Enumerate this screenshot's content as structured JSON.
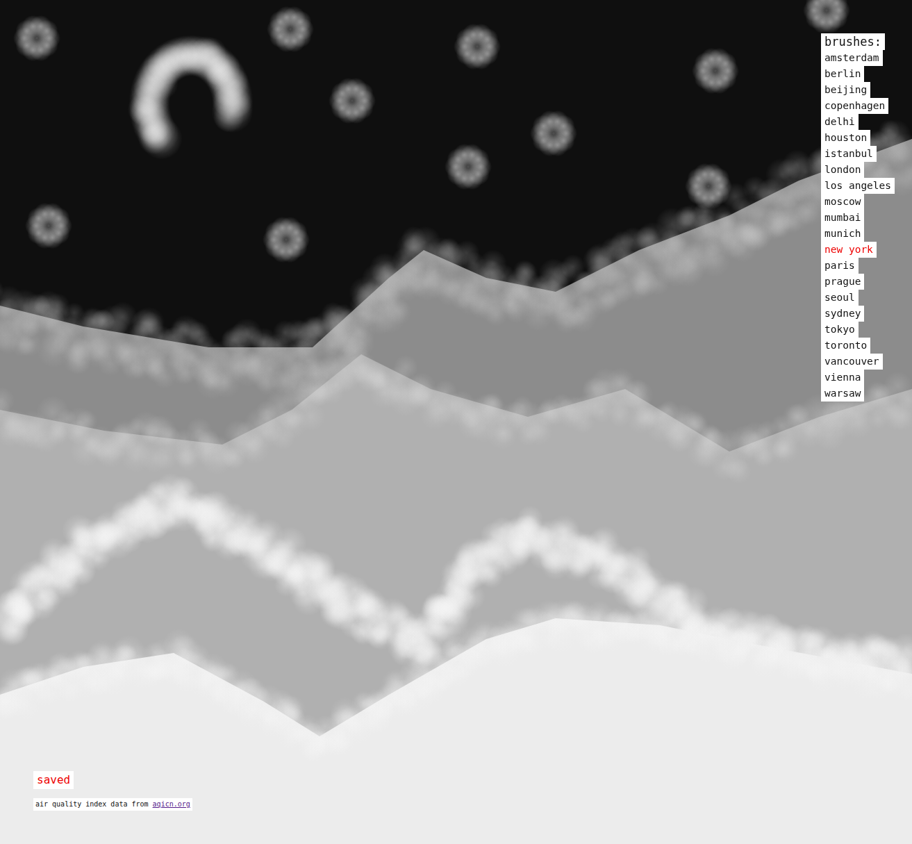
{
  "brushes": {
    "title": "brushes:",
    "items": [
      {
        "label": "amsterdam",
        "selected": false
      },
      {
        "label": "berlin",
        "selected": false
      },
      {
        "label": "beijing",
        "selected": false
      },
      {
        "label": "copenhagen",
        "selected": false
      },
      {
        "label": "delhi",
        "selected": false
      },
      {
        "label": "houston",
        "selected": false
      },
      {
        "label": "istanbul",
        "selected": false
      },
      {
        "label": "london",
        "selected": false
      },
      {
        "label": "los angeles",
        "selected": false
      },
      {
        "label": "moscow",
        "selected": false
      },
      {
        "label": "mumbai",
        "selected": false
      },
      {
        "label": "munich",
        "selected": false
      },
      {
        "label": "new york",
        "selected": true
      },
      {
        "label": "paris",
        "selected": false
      },
      {
        "label": "prague",
        "selected": false
      },
      {
        "label": "seoul",
        "selected": false
      },
      {
        "label": "sydney",
        "selected": false
      },
      {
        "label": "tokyo",
        "selected": false
      },
      {
        "label": "toronto",
        "selected": false
      },
      {
        "label": "vancouver",
        "selected": false
      },
      {
        "label": "vienna",
        "selected": false
      },
      {
        "label": "warsaw",
        "selected": false
      }
    ]
  },
  "status": "saved",
  "credit": {
    "text": "air quality index data from",
    "link": "aqicn.org"
  }
}
